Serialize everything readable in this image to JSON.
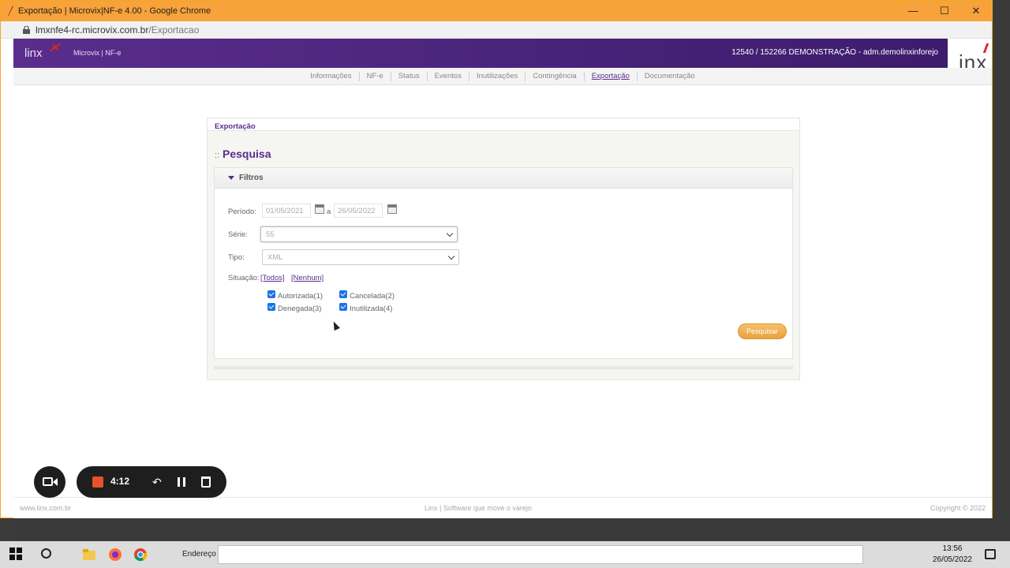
{
  "browser": {
    "title": "Exportação | Microvix|NF-e 4.00 - Google Chrome",
    "url_host": "lmxnfe4-rc.microvix.com.br",
    "url_path": "/Exportacao",
    "controls": {
      "minimize": "—",
      "maximize": "☐",
      "close": "✕"
    }
  },
  "header": {
    "logo": "linx",
    "product": "Microvix | NF-e",
    "account": "12540 / 152266 DEMONSTRAÇÃO - adm.demolinxinforejo",
    "user_logo_text": "inx"
  },
  "nav": {
    "items": [
      {
        "label": "Informações"
      },
      {
        "label": "NF-e"
      },
      {
        "label": "Status"
      },
      {
        "label": "Eventos"
      },
      {
        "label": "Inutilizações"
      },
      {
        "label": "Contingência"
      },
      {
        "label": "Exportação",
        "active": true
      },
      {
        "label": "Documentação"
      }
    ]
  },
  "panel": {
    "title": "Exportação",
    "section_prefix": "::",
    "section_title": "Pesquisa",
    "filters_title": "Filtros",
    "period_label": "Período:",
    "date_from": "01/05/2021",
    "date_sep": "a",
    "date_to": "26/05/2022",
    "serie_label": "Série:",
    "serie_value": "55",
    "tipo_label": "Tipo:",
    "tipo_value": "XML",
    "situacao_label": "Situação:",
    "todos_link": "[Todos]",
    "nenhum_link": "[Nenhum]",
    "checks": [
      {
        "label": "Autorizada(1)",
        "checked": true
      },
      {
        "label": "Cancelada(2)",
        "checked": true
      },
      {
        "label": "Denegada(3)",
        "checked": true
      },
      {
        "label": "Inutilizada(4)",
        "checked": true
      }
    ],
    "search_button": "Pesquisar"
  },
  "footer": {
    "left": "www.linx.com.br",
    "center": "Linx | Software que move o varejo",
    "right": "Copyright © 2022"
  },
  "recorder": {
    "time": "4:12",
    "undo_glyph": "↶"
  },
  "taskbar": {
    "address_label": "Endereço",
    "time": "13:56",
    "date": "26/05/2022"
  },
  "colors": {
    "brand": "#5a2d8c",
    "accent": "#f7a23a",
    "button": "#e8a23c"
  }
}
